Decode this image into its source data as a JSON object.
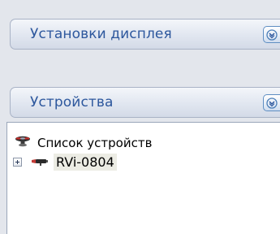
{
  "sections": {
    "display": {
      "title": "Установки дисплея",
      "icon": "chevron-down-icon"
    },
    "devices": {
      "title": "Устройства",
      "icon": "chevron-down-icon"
    }
  },
  "tree": {
    "root": {
      "label": "Список устройств",
      "icon": "device-list-icon"
    },
    "children": [
      {
        "label": "RVi-0804",
        "icon": "camera-icon",
        "expander": "expand-plus-icon"
      }
    ]
  },
  "colors": {
    "header_text": "#2d579d",
    "header_border": "#a9b3c6",
    "panel_background": "#e3e6ec",
    "tree_background": "#ffffff",
    "selection_background": "#ecece4"
  }
}
